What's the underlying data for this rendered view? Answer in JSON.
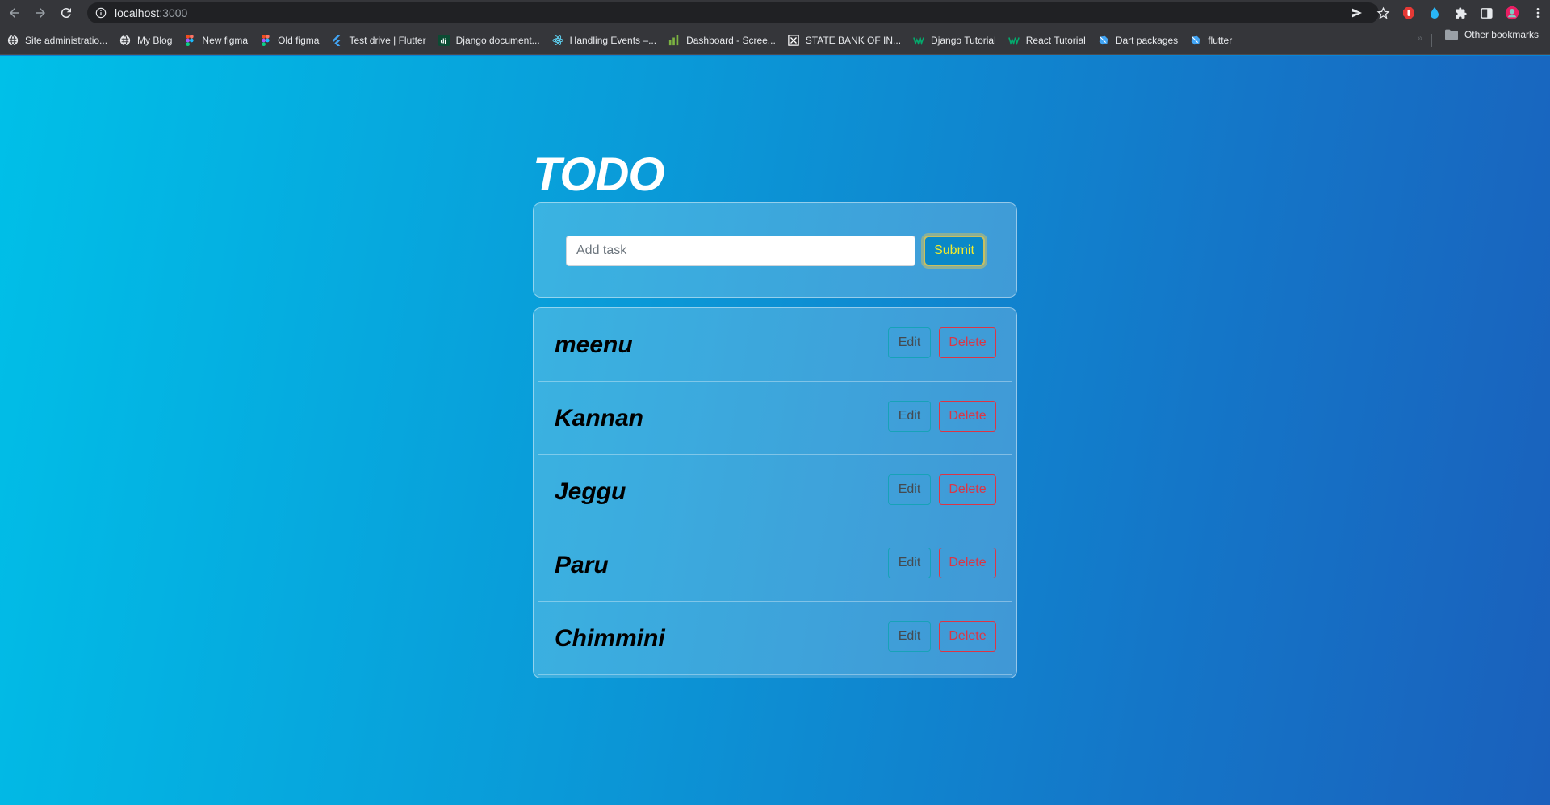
{
  "browser": {
    "url_host": "localhost",
    "url_port": ":3000",
    "bookmarks": [
      {
        "label": "Site administratio...",
        "icon": "globe-icon",
        "color": "#e8eaed"
      },
      {
        "label": "My Blog",
        "icon": "globe-icon",
        "color": "#e8eaed"
      },
      {
        "label": "New figma",
        "icon": "figma-icon",
        "color": "#f24e1e"
      },
      {
        "label": "Old figma",
        "icon": "figma-icon",
        "color": "#f24e1e"
      },
      {
        "label": "Test drive | Flutter",
        "icon": "flutter-icon",
        "color": "#42a5f5"
      },
      {
        "label": "Django document...",
        "icon": "django-icon",
        "color": "#0c4b33"
      },
      {
        "label": "Handling Events –...",
        "icon": "react-icon",
        "color": "#61dafb"
      },
      {
        "label": "Dashboard - Scree...",
        "icon": "bar-chart-icon",
        "color": "#7cb342"
      },
      {
        "label": "STATE BANK OF IN...",
        "icon": "excel-icon",
        "color": "#ffffff"
      },
      {
        "label": "Django Tutorial",
        "icon": "w3-icon",
        "color": "#04aa6d"
      },
      {
        "label": "React Tutorial",
        "icon": "w3-icon",
        "color": "#04aa6d"
      },
      {
        "label": "Dart packages",
        "icon": "dart-icon",
        "color": "#42a5f5"
      },
      {
        "label": "flutter",
        "icon": "dart-icon",
        "color": "#42a5f5"
      }
    ],
    "other_bookmarks": "Other bookmarks"
  },
  "app": {
    "title": "TODO",
    "input_placeholder": "Add task",
    "input_value": "",
    "submit_label": "Submit",
    "todos": [
      {
        "name": "meenu",
        "edit_label": "Edit",
        "delete_label": "Delete"
      },
      {
        "name": "Kannan",
        "edit_label": "Edit",
        "delete_label": "Delete"
      },
      {
        "name": "Jeggu",
        "edit_label": "Edit",
        "delete_label": "Delete"
      },
      {
        "name": "Paru",
        "edit_label": "Edit",
        "delete_label": "Delete"
      },
      {
        "name": "Chimmini",
        "edit_label": "Edit",
        "delete_label": "Delete"
      }
    ]
  }
}
